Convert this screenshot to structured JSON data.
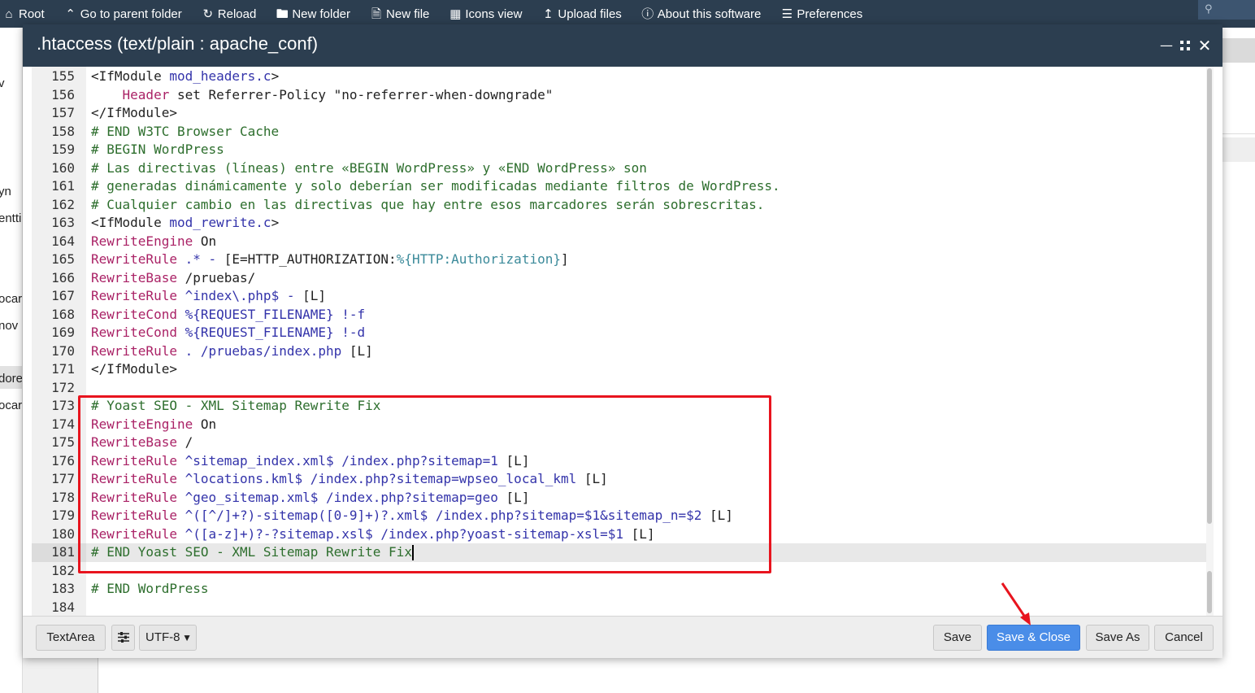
{
  "toolbar": {
    "items": [
      {
        "label": "Root",
        "icon": "home-icon"
      },
      {
        "label": "Go to parent folder",
        "icon": "chevron-up-icon"
      },
      {
        "label": "Reload",
        "icon": "reload-icon"
      },
      {
        "label": "New folder",
        "icon": "folder-icon"
      },
      {
        "label": "New file",
        "icon": "file-icon"
      },
      {
        "label": "Icons view",
        "icon": "grid-icon"
      },
      {
        "label": "Upload files",
        "icon": "upload-icon"
      },
      {
        "label": "About this software",
        "icon": "help-icon"
      },
      {
        "label": "Preferences",
        "icon": "sliders-icon"
      }
    ],
    "search_icon": "search-icon"
  },
  "background": {
    "sidebar_fragments": [
      "v",
      "yn",
      "entti",
      "ocar",
      "nov",
      "dore",
      "ocar"
    ]
  },
  "editor": {
    "title": ".htaccess (text/plain : apache_conf)",
    "controls": [
      "minimize-icon",
      "maximize-icon",
      "close-icon"
    ],
    "active_line": 181,
    "lines": [
      {
        "n": "155",
        "tokens": [
          {
            "t": "tag",
            "v": "<IfModule "
          },
          {
            "t": "attr",
            "v": "mod_headers.c"
          },
          {
            "t": "tag",
            "v": ">"
          }
        ]
      },
      {
        "n": "156",
        "tokens": [
          {
            "t": "plain",
            "v": "    "
          },
          {
            "t": "kw",
            "v": "Header"
          },
          {
            "t": "plain",
            "v": " set Referrer-Policy \"no-referrer-when-downgrade\""
          }
        ]
      },
      {
        "n": "157",
        "tokens": [
          {
            "t": "tag",
            "v": "</IfModule>"
          }
        ]
      },
      {
        "n": "158",
        "tokens": [
          {
            "t": "cmt",
            "v": "# END W3TC Browser Cache"
          }
        ]
      },
      {
        "n": "159",
        "tokens": [
          {
            "t": "cmt",
            "v": "# BEGIN WordPress"
          }
        ]
      },
      {
        "n": "160",
        "tokens": [
          {
            "t": "cmt",
            "v": "# Las directivas (líneas) entre «BEGIN WordPress» y «END WordPress» son"
          }
        ]
      },
      {
        "n": "161",
        "tokens": [
          {
            "t": "cmt",
            "v": "# generadas dinámicamente y solo deberían ser modificadas mediante filtros de WordPress."
          }
        ]
      },
      {
        "n": "162",
        "tokens": [
          {
            "t": "cmt",
            "v": "# Cualquier cambio en las directivas que hay entre esos marcadores serán sobrescritas."
          }
        ]
      },
      {
        "n": "163",
        "tokens": [
          {
            "t": "tag",
            "v": "<IfModule "
          },
          {
            "t": "attr",
            "v": "mod_rewrite.c"
          },
          {
            "t": "tag",
            "v": ">"
          }
        ]
      },
      {
        "n": "164",
        "tokens": [
          {
            "t": "kw",
            "v": "RewriteEngine"
          },
          {
            "t": "plain",
            "v": " On"
          }
        ]
      },
      {
        "n": "165",
        "tokens": [
          {
            "t": "kw",
            "v": "RewriteRule"
          },
          {
            "t": "var",
            "v": " .* - "
          },
          {
            "t": "plain",
            "v": "[E=HTTP_AUTHORIZATION:"
          },
          {
            "t": "env",
            "v": "%{HTTP:Authorization}"
          },
          {
            "t": "plain",
            "v": "]"
          }
        ]
      },
      {
        "n": "166",
        "tokens": [
          {
            "t": "kw",
            "v": "RewriteBase"
          },
          {
            "t": "plain",
            "v": " /pruebas/"
          }
        ]
      },
      {
        "n": "167",
        "tokens": [
          {
            "t": "kw",
            "v": "RewriteRule"
          },
          {
            "t": "var",
            "v": " ^index\\.php$ - "
          },
          {
            "t": "plain",
            "v": "[L]"
          }
        ]
      },
      {
        "n": "168",
        "tokens": [
          {
            "t": "kw",
            "v": "RewriteCond"
          },
          {
            "t": "var",
            "v": " %{REQUEST_FILENAME} !-f"
          }
        ]
      },
      {
        "n": "169",
        "tokens": [
          {
            "t": "kw",
            "v": "RewriteCond"
          },
          {
            "t": "var",
            "v": " %{REQUEST_FILENAME} !-d"
          }
        ]
      },
      {
        "n": "170",
        "tokens": [
          {
            "t": "kw",
            "v": "RewriteRule"
          },
          {
            "t": "var",
            "v": " . /pruebas/index.php "
          },
          {
            "t": "plain",
            "v": "[L]"
          }
        ]
      },
      {
        "n": "171",
        "tokens": [
          {
            "t": "tag",
            "v": "</IfModule>"
          }
        ]
      },
      {
        "n": "172",
        "tokens": []
      },
      {
        "n": "173",
        "tokens": [
          {
            "t": "cmt",
            "v": "# Yoast SEO - XML Sitemap Rewrite Fix"
          }
        ]
      },
      {
        "n": "174",
        "tokens": [
          {
            "t": "kw",
            "v": "RewriteEngine"
          },
          {
            "t": "plain",
            "v": " On"
          }
        ]
      },
      {
        "n": "175",
        "tokens": [
          {
            "t": "kw",
            "v": "RewriteBase"
          },
          {
            "t": "plain",
            "v": " /"
          }
        ]
      },
      {
        "n": "176",
        "tokens": [
          {
            "t": "kw",
            "v": "RewriteRule"
          },
          {
            "t": "var",
            "v": " ^sitemap_index.xml$ /index.php?sitemap=1 "
          },
          {
            "t": "plain",
            "v": "[L]"
          }
        ]
      },
      {
        "n": "177",
        "tokens": [
          {
            "t": "kw",
            "v": "RewriteRule"
          },
          {
            "t": "var",
            "v": " ^locations.kml$ /index.php?sitemap=wpseo_local_kml "
          },
          {
            "t": "plain",
            "v": "[L]"
          }
        ]
      },
      {
        "n": "178",
        "tokens": [
          {
            "t": "kw",
            "v": "RewriteRule"
          },
          {
            "t": "var",
            "v": " ^geo_sitemap.xml$ /index.php?sitemap=geo "
          },
          {
            "t": "plain",
            "v": "[L]"
          }
        ]
      },
      {
        "n": "179",
        "tokens": [
          {
            "t": "kw",
            "v": "RewriteRule"
          },
          {
            "t": "var",
            "v": " ^([^/]+?)-sitemap([0-9]+)?.xml$ /index.php?sitemap=$1&sitemap_n=$2 "
          },
          {
            "t": "plain",
            "v": "[L]"
          }
        ]
      },
      {
        "n": "180",
        "tokens": [
          {
            "t": "kw",
            "v": "RewriteRule"
          },
          {
            "t": "var",
            "v": " ^([a-z]+)?-?sitemap.xsl$ /index.php?yoast-sitemap-xsl=$1 "
          },
          {
            "t": "plain",
            "v": "[L]"
          }
        ]
      },
      {
        "n": "181",
        "tokens": [
          {
            "t": "cmt",
            "v": "# END Yoast SEO - XML Sitemap Rewrite Fix"
          }
        ]
      },
      {
        "n": "182",
        "tokens": []
      },
      {
        "n": "183",
        "tokens": [
          {
            "t": "cmt",
            "v": "# END WordPress"
          }
        ]
      },
      {
        "n": "184",
        "tokens": []
      }
    ]
  },
  "footer": {
    "textarea_label": "TextArea",
    "settings_icon": "sliders-icon",
    "encoding": "UTF-8",
    "save_label": "Save",
    "save_close_label": "Save & Close",
    "save_as_label": "Save As",
    "cancel_label": "Cancel"
  },
  "colors": {
    "header": "#2c3e50",
    "primary": "#4a8de8",
    "highlight": "#e8141e",
    "comment": "#2d6e2d",
    "keyword": "#aa2266",
    "variable": "#3333aa",
    "env": "#3b8a9a"
  }
}
